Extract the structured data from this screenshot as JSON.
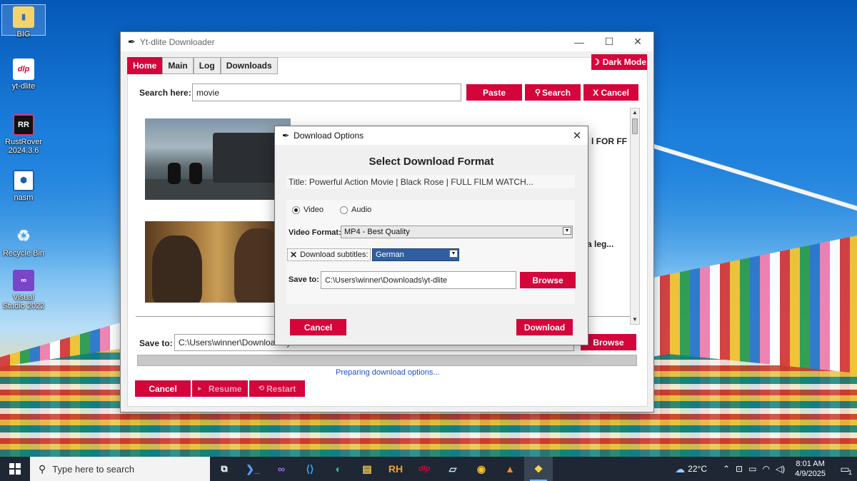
{
  "desktop": {
    "icons": [
      {
        "label": "BIG"
      },
      {
        "label": "yt-dlite"
      },
      {
        "label": "RustRover 2024.3.6"
      },
      {
        "label": "nasm"
      },
      {
        "label": "Recycle Bin"
      },
      {
        "label": "Visual Studio 2022"
      }
    ]
  },
  "app": {
    "title": "Yt-dlite Downloader",
    "window_controls": {
      "minimize": "—",
      "maximize": "☐",
      "close": "✕"
    },
    "tabs": [
      {
        "label": "Home",
        "active": true
      },
      {
        "label": "Main"
      },
      {
        "label": "Log"
      },
      {
        "label": "Downloads"
      }
    ],
    "dark_mode_label": "Dark Mode",
    "search": {
      "label": "Search here:",
      "value": "movie",
      "paste_label": "Paste",
      "search_label": "Search",
      "cancel_label": "X Cancel"
    },
    "results": [
      {
        "title_fragment": "l FOR FF"
      },
      {
        "title_fragment": "a leg..."
      }
    ],
    "save_to": {
      "label": "Save to:",
      "value": "C:\\Users\\winner\\Downloads\\yt-dlite",
      "browse_label": "Browse"
    },
    "progress": 0,
    "status": "Preparing download options...",
    "buttons": {
      "cancel": "Cancel",
      "resume": "Resume",
      "restart": "Restart"
    }
  },
  "dialog": {
    "title": "Download Options",
    "heading": "Select Download Format",
    "video_title": "Title: Powerful Action Movie | Black Rose | FULL FILM WATCH...",
    "media_type": {
      "video_label": "Video",
      "audio_label": "Audio",
      "selected": "Video"
    },
    "video_format": {
      "label": "Video Format:",
      "value": "MP4 - Best Quality"
    },
    "subtitles": {
      "label": "Download subtitles:",
      "checked": true,
      "language": "German"
    },
    "save_to": {
      "label": "Save to:",
      "value": "C:\\Users\\winner\\Downloads\\yt-dlite",
      "browse_label": "Browse"
    },
    "cancel_label": "Cancel",
    "download_label": "Download"
  },
  "taskbar": {
    "search_placeholder": "Type here to search",
    "apps": [
      "task-view",
      "powershell",
      "visual-studio",
      "vscode",
      "edge",
      "file-explorer",
      "rubymine",
      "yt-dlite",
      "notepad",
      "chrome",
      "vlc",
      "python"
    ],
    "weather": "22°C",
    "time": "8:01 AM",
    "date": "4/9/2025",
    "notification_count": "1"
  },
  "colors": {
    "accent_red": "#d4053a",
    "status_blue": "#1d4fd8",
    "taskbar": "#1e2733"
  }
}
